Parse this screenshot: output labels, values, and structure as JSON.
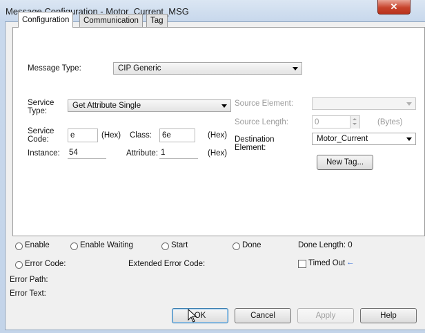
{
  "window": {
    "title": "Message Configuration - Motor_Current_MSG",
    "close_glyph": "✕"
  },
  "tabs": [
    {
      "label": "Configuration",
      "active": true
    },
    {
      "label": "Communication",
      "active": false
    },
    {
      "label": "Tag",
      "active": false
    }
  ],
  "config": {
    "message_type_label": "Message Type:",
    "message_type_value": "CIP Generic",
    "service_type_label_1": "Service",
    "service_type_label_2": "Type:",
    "service_type_value": "Get Attribute Single",
    "service_code_label_1": "Service",
    "service_code_label_2": "Code:",
    "service_code_value": "e",
    "hex_label": "(Hex)",
    "class_label": "Class:",
    "class_value": "6e",
    "instance_label": "Instance:",
    "instance_value": "54",
    "attribute_label": "Attribute:",
    "attribute_value": "1",
    "source_element_label": "Source Element:",
    "source_element_value": "",
    "source_length_label": "Source Length:",
    "source_length_value": "0",
    "bytes_label": "(Bytes)",
    "destination_label_1": "Destination",
    "destination_label_2": "Element:",
    "destination_value": "Motor_Current",
    "new_tag_label": "New Tag..."
  },
  "status": {
    "enable": "Enable",
    "enable_waiting": "Enable Waiting",
    "start": "Start",
    "done": "Done",
    "done_length": "Done Length: 0",
    "error_code": "Error Code:",
    "extended_error_code": "Extended Error Code:",
    "timed_out": "Timed Out",
    "timed_out_arrow": "←",
    "error_path": "Error Path:",
    "error_text": "Error Text:"
  },
  "buttons": {
    "ok": "OK",
    "cancel": "Cancel",
    "apply": "Apply",
    "help": "Help"
  },
  "colors": {
    "accent_arrow": "#1f5fd6",
    "title_bg": "#c8d8ec"
  }
}
